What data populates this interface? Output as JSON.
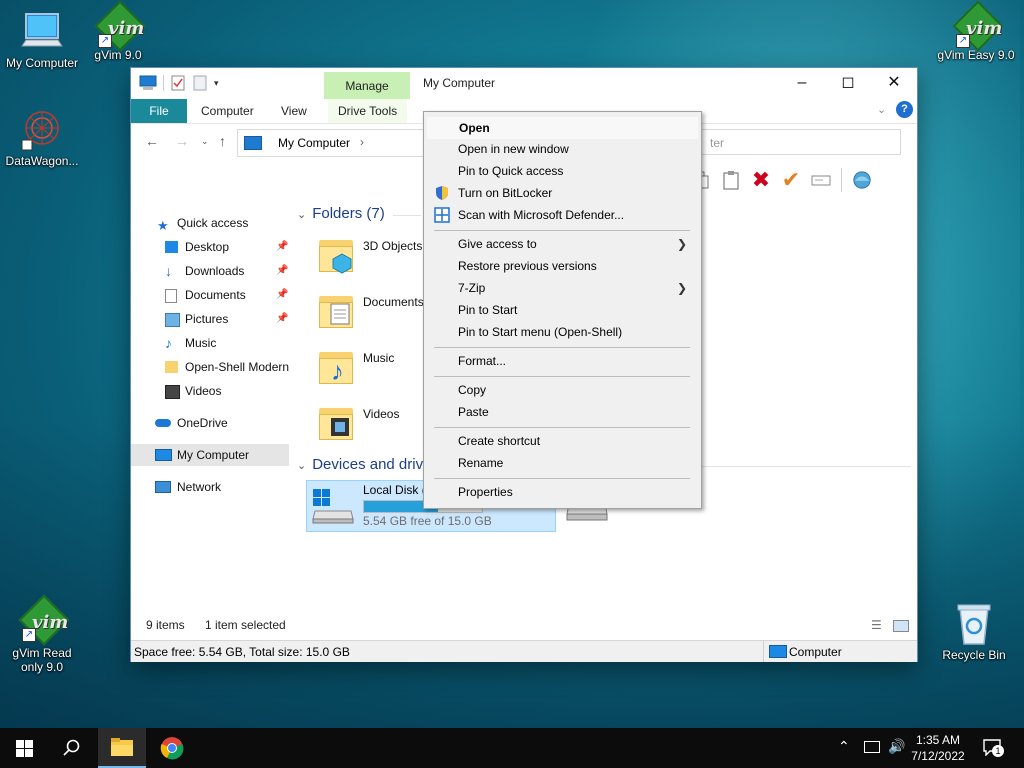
{
  "desktop": {
    "icons": [
      {
        "label": "My Computer"
      },
      {
        "label": "gVim 9.0"
      },
      {
        "label": "DataWagon..."
      },
      {
        "label": "gVim Easy 9.0"
      },
      {
        "label": "gVim Read only 9.0"
      },
      {
        "label": "Recycle Bin"
      }
    ]
  },
  "window": {
    "title": "My Computer",
    "manage_tab": "Manage",
    "ribbon_tabs": [
      "File",
      "Computer",
      "View",
      "Drive Tools"
    ],
    "address": {
      "path": "My Computer",
      "search_placeholder": "ter"
    },
    "nav": {
      "items": [
        {
          "label": "Quick access"
        },
        {
          "label": "Desktop"
        },
        {
          "label": "Downloads"
        },
        {
          "label": "Documents"
        },
        {
          "label": "Pictures"
        },
        {
          "label": "Music"
        },
        {
          "label": "Open-Shell Modern"
        },
        {
          "label": "Videos"
        },
        {
          "label": "OneDrive"
        },
        {
          "label": "My Computer"
        },
        {
          "label": "Network"
        }
      ]
    },
    "content": {
      "folders_header": "Folders (7)",
      "folders": [
        {
          "label": "3D Objects"
        },
        {
          "label": "Documents"
        },
        {
          "label": "Music"
        },
        {
          "label": "Videos"
        }
      ],
      "devices_header": "Devices and driv",
      "drive": {
        "name": "Local Disk (",
        "free": "5.54 GB free of 15.0 GB",
        "used_fraction": 0.63
      }
    },
    "status": {
      "items": "9 items",
      "selected": "1 item selected"
    },
    "details": {
      "space": "Space free: 5.54 GB, Total size: 15.0 GB",
      "location": "Computer"
    }
  },
  "context_menu": {
    "items": [
      {
        "label": "Open"
      },
      {
        "label": "Open in new window"
      },
      {
        "label": "Pin to Quick access"
      },
      {
        "label": "Turn on BitLocker"
      },
      {
        "label": "Scan with Microsoft Defender..."
      },
      {
        "label": "Give access to"
      },
      {
        "label": "Restore previous versions"
      },
      {
        "label": "7-Zip"
      },
      {
        "label": "Pin to Start"
      },
      {
        "label": "Pin to Start menu (Open-Shell)"
      },
      {
        "label": "Format..."
      },
      {
        "label": "Copy"
      },
      {
        "label": "Paste"
      },
      {
        "label": "Create shortcut"
      },
      {
        "label": "Rename"
      },
      {
        "label": "Properties"
      }
    ]
  },
  "taskbar": {
    "time": "1:35 AM",
    "date": "7/12/2022",
    "notification_count": "1"
  },
  "colors": {
    "accent": "#1a8a9a",
    "selection": "#cce8ff",
    "manage_tab": "#c9f0b4"
  }
}
